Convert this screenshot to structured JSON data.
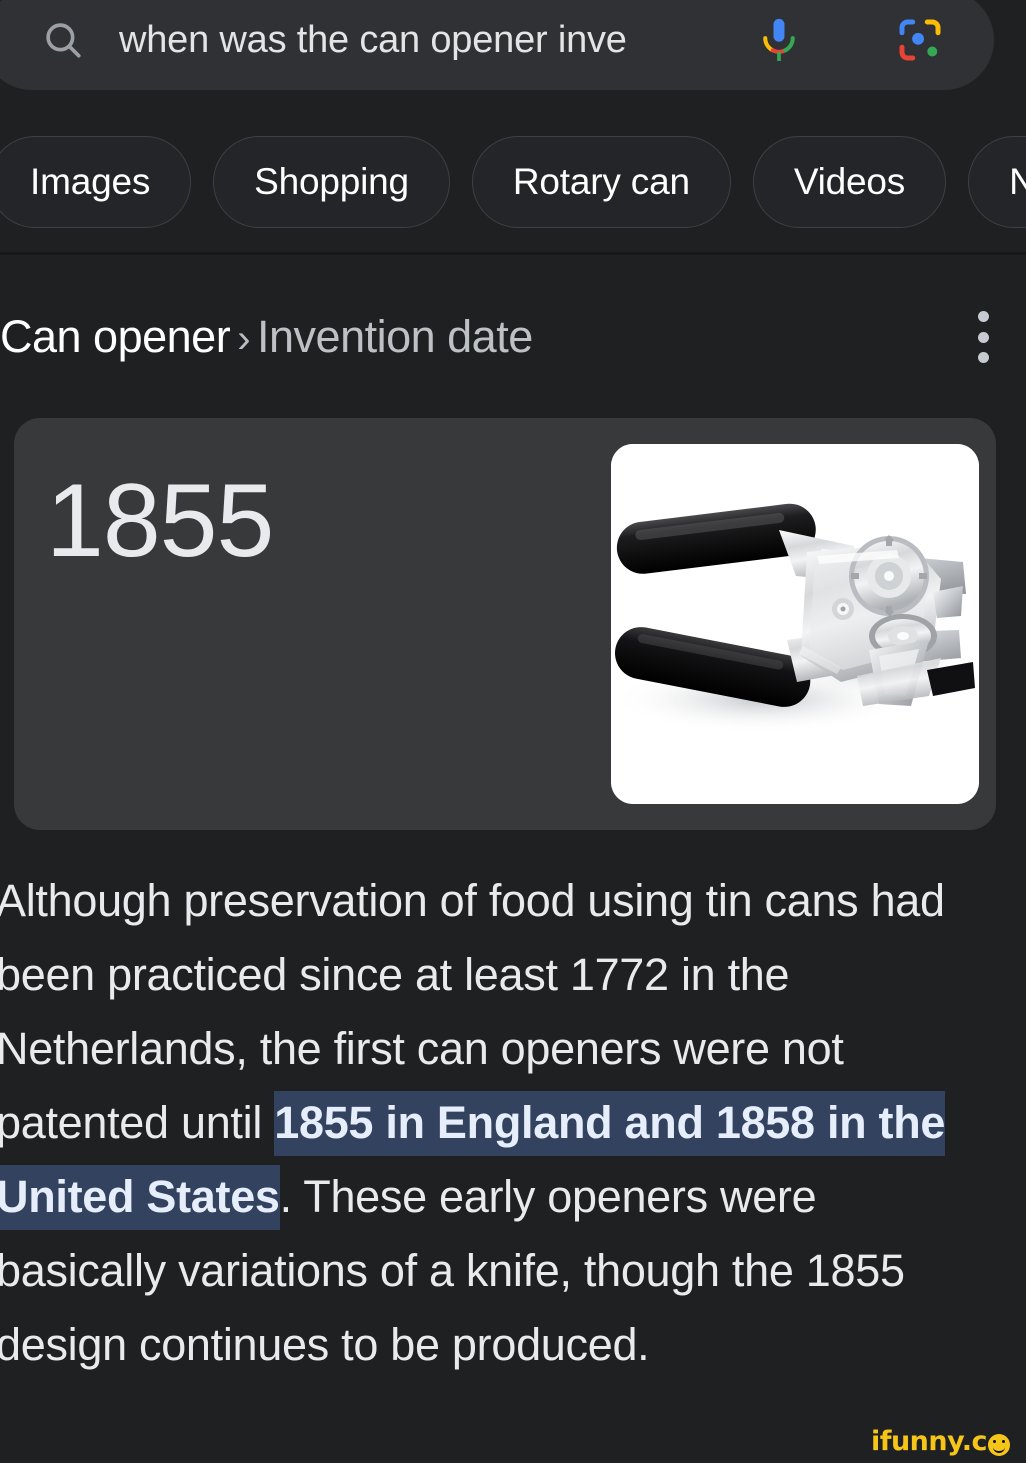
{
  "search": {
    "query": "when was the can opener inve",
    "icon_search": "search-icon",
    "icon_mic": "microphone-icon",
    "icon_lens": "google-lens-icon"
  },
  "chips": [
    {
      "label": "Images"
    },
    {
      "label": "Shopping"
    },
    {
      "label": "Rotary can"
    },
    {
      "label": "Videos"
    },
    {
      "label": "News"
    }
  ],
  "knowledge_panel": {
    "entity": "Can opener",
    "separator": "›",
    "attribute": "Invention date",
    "overflow_icon": "more-vertical-icon",
    "answer_value": "1855",
    "image_alt": "manual can opener with black handles"
  },
  "description": {
    "part1": "Although preservation of food using tin cans had been practiced since at least 1772 in the Netherlands, the first can openers were not patented until ",
    "highlight": "1855 in England and 1858 in the United States",
    "part2": ". These early openers were basically variations of a knife, though the 1855 design continues to be produced."
  },
  "watermark": {
    "text": "ifunny.c",
    "color": "#f5c518"
  },
  "colors": {
    "page_bg": "#1f2022",
    "searchbar_bg": "#303134",
    "card_bg": "#37393b",
    "chip_bg": "#242528",
    "chip_border": "#3e4044",
    "text_primary": "#e8eaed",
    "text_secondary": "#bdc1c6",
    "highlight_bg": "#33425e",
    "highlight_text": "#e6eefb"
  }
}
